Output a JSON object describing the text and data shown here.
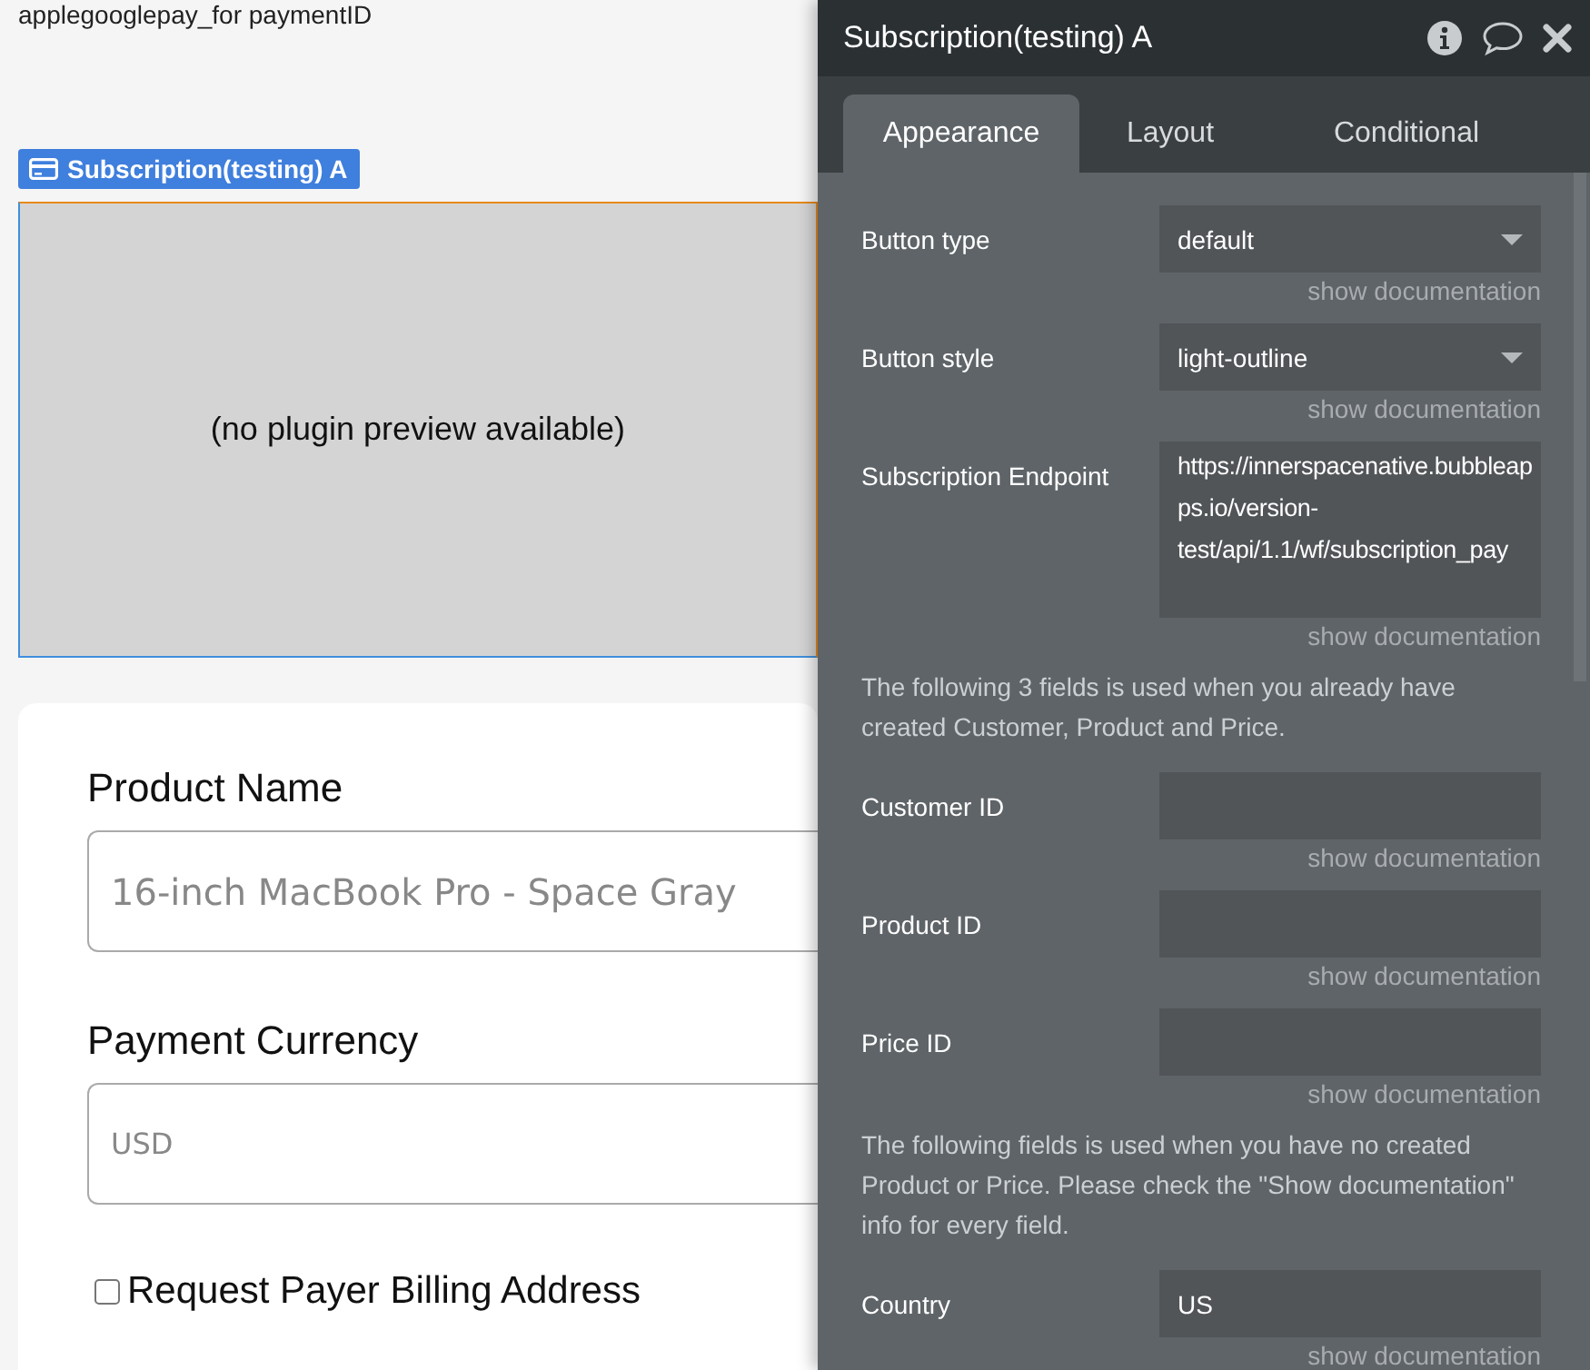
{
  "canvas": {
    "top_text": "applegooglepay_for paymentID",
    "element_label": "Subscription(testing) A",
    "preview_text": "(no plugin preview available)",
    "form": {
      "fields": [
        {
          "label": "Product Name",
          "placeholder": "16-inch MacBook Pro - Space Gray"
        },
        {
          "label": "Payment Currency",
          "placeholder": "USD"
        }
      ],
      "checkbox": {
        "label": "Request Payer Billing Address",
        "checked": false
      }
    }
  },
  "panel": {
    "title": "Subscription(testing) A",
    "tabs": [
      {
        "label": "Appearance",
        "selected": true
      },
      {
        "label": "Layout",
        "selected": false
      },
      {
        "label": "Conditional",
        "selected": false
      }
    ],
    "rows": [
      {
        "kind": "dropdown",
        "label": "Button type",
        "value": "default",
        "doc": "show documentation"
      },
      {
        "kind": "dropdown",
        "label": "Button style",
        "value": "light-outline",
        "doc": "show documentation"
      },
      {
        "kind": "textarea",
        "label": "Subscription Endpoint",
        "value": "https://innerspacenative.bubbleapps.io/version-test/api/1.1/wf/subscription_pay",
        "doc": "show documentation"
      },
      {
        "kind": "note",
        "text": "The following 3 fields is used when you already have created Customer, Product and Price."
      },
      {
        "kind": "input",
        "label": "Customer ID",
        "value": "",
        "doc": "show documentation"
      },
      {
        "kind": "input",
        "label": "Product ID",
        "value": "",
        "doc": "show documentation"
      },
      {
        "kind": "input",
        "label": "Price ID",
        "value": "",
        "doc": "show documentation"
      },
      {
        "kind": "note",
        "text": "The following fields is used when you have no created Product or Price. Please check the \"Show documentation\" info for every field."
      },
      {
        "kind": "input",
        "label": "Country",
        "value": "US",
        "doc": "show documentation"
      }
    ]
  }
}
